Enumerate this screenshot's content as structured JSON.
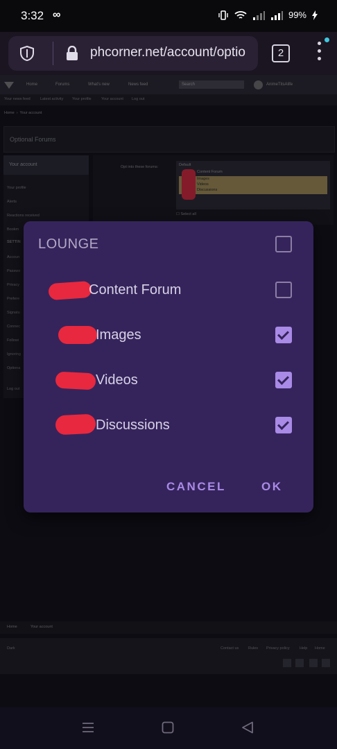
{
  "status_bar": {
    "time": "3:32",
    "infinity": "∞",
    "battery": "99%"
  },
  "browser": {
    "url": "phcorner.net/account/optio",
    "tab_count": "2"
  },
  "site": {
    "nav": [
      "Home",
      "Forums",
      "What's new",
      "News feed"
    ],
    "search_placeholder": "Search",
    "username": "AnimeTitsAlife",
    "subnav": [
      "Your news feed",
      "Latest activity",
      "Your profile",
      "Your account",
      "Log out"
    ],
    "breadcrumb": [
      "Home",
      "Your account"
    ],
    "optional_forums_title": "Optional Forums",
    "sidebar_header": "Your account",
    "sidebar_items": [
      "Your profile",
      "Alerts",
      "Reactions received",
      "Bookm",
      "SETTIN",
      "Accoun",
      "Passwo",
      "Privacy",
      "Prefere",
      "Signatu",
      "Connec",
      "Followi",
      "Ignoring",
      "Optiona"
    ],
    "sidebar_logout": "Log out",
    "opt_label": "Opt into these forums:",
    "list_items": [
      "Content Forum",
      "Images",
      "Videos",
      "Discussions"
    ],
    "list_default": "Default",
    "select_all": "Select all",
    "footer_crumb": [
      "Home",
      "Your account"
    ],
    "footer_links": [
      "Contact us",
      "Rules",
      "Privacy policy",
      "Help",
      "Home"
    ],
    "footer_left": "Dark"
  },
  "dialog": {
    "title": "LOUNGE",
    "title_checked": false,
    "items": [
      {
        "label": "Content Forum",
        "checked": false
      },
      {
        "label": "Images",
        "checked": true
      },
      {
        "label": "Videos",
        "checked": true
      },
      {
        "label": "Discussions",
        "checked": true
      }
    ],
    "cancel_label": "CANCEL",
    "ok_label": "OK"
  },
  "colors": {
    "accent": "#a98ae6",
    "dialog_bg": "#35245c",
    "redaction": "#e8283e"
  }
}
